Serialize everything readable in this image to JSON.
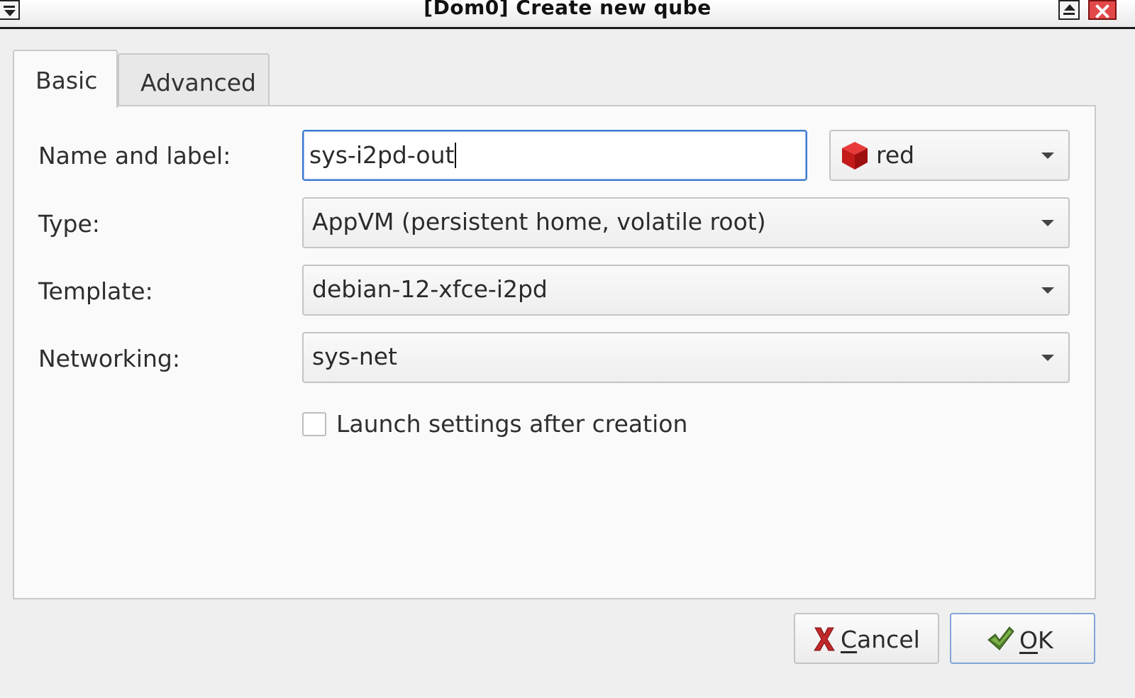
{
  "window": {
    "title": "[Dom0] Create new qube"
  },
  "tabs": [
    {
      "label": "Basic",
      "active": true
    },
    {
      "label": "Advanced",
      "active": false
    }
  ],
  "form": {
    "name_label": "Name and label:",
    "name_value": "sys-i2pd-out",
    "label_value": "red",
    "label_color": "#cc1c1c",
    "type_label": "Type:",
    "type_value": "AppVM (persistent home, volatile root)",
    "template_label": "Template:",
    "template_value": "debian-12-xfce-i2pd",
    "networking_label": "Networking:",
    "networking_value": "sys-net",
    "launch_settings_label": "Launch settings after creation",
    "launch_settings_checked": false
  },
  "buttons": {
    "cancel_mnemonic": "C",
    "cancel_rest": "ancel",
    "ok_mnemonic": "O",
    "ok_rest": "K"
  },
  "icons": {
    "window_menu": "window-menu-icon",
    "maximize": "maximize-icon",
    "close": "close-icon",
    "label_color": "cube-icon",
    "cancel": "red-x-icon",
    "ok": "green-checkmark-icon"
  }
}
